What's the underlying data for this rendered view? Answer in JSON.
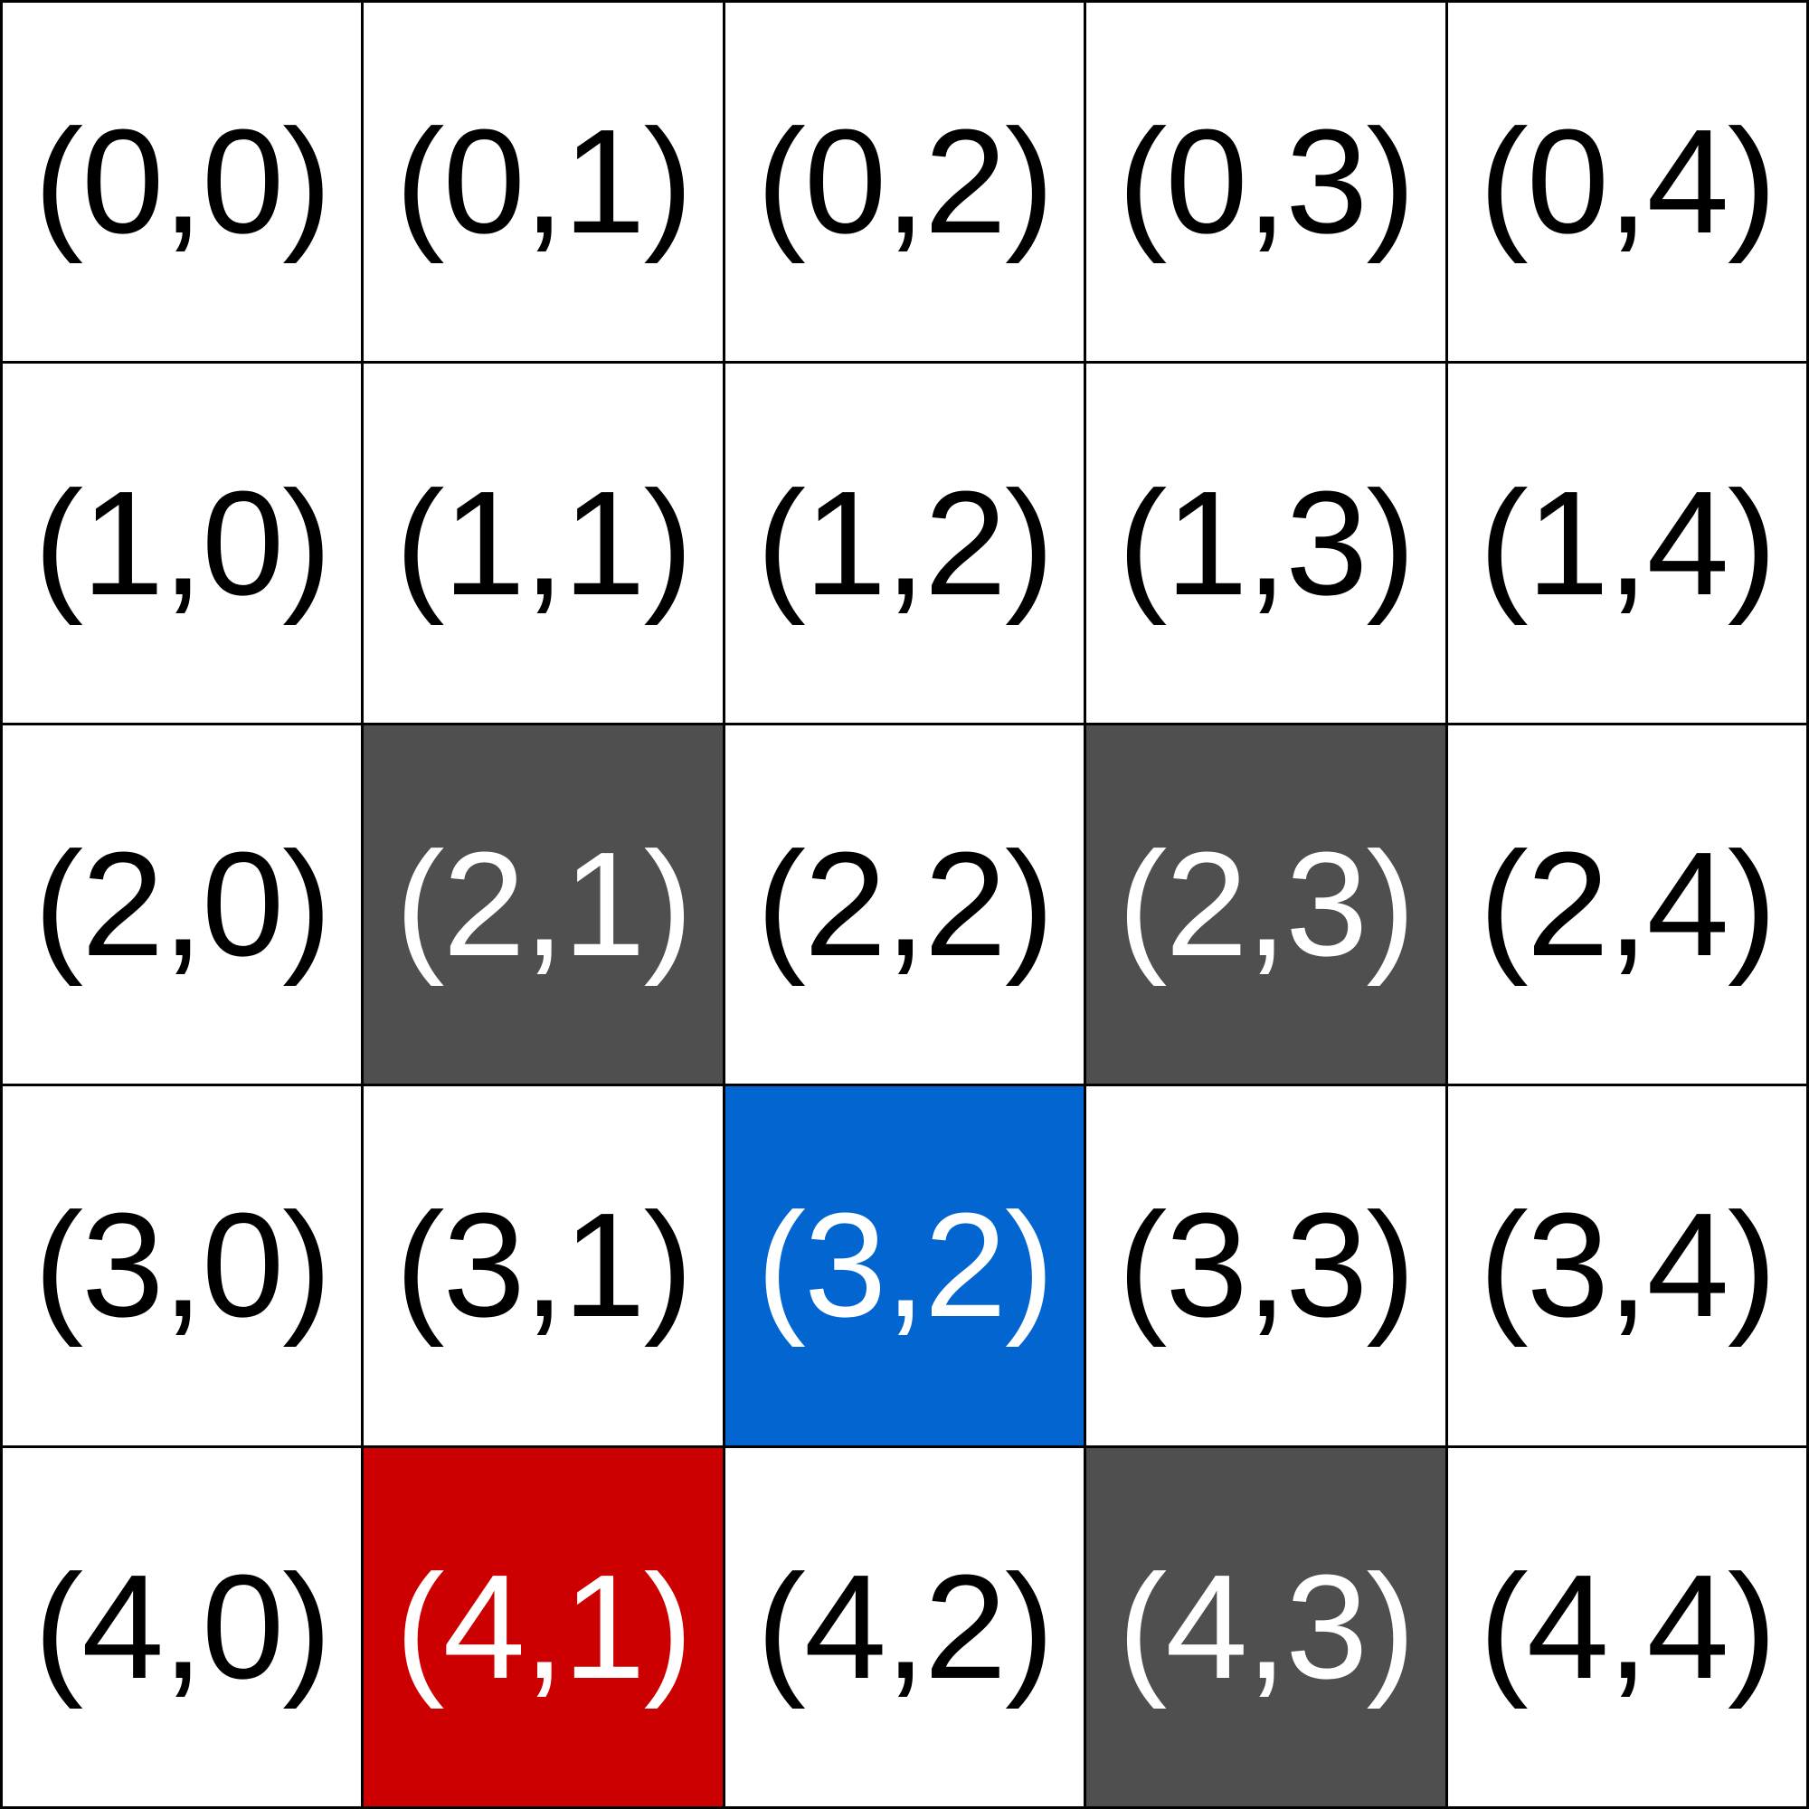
{
  "colors": {
    "empty": "#ffffff",
    "wall": "#4f4f4f",
    "agent": "#0366d0",
    "goal": "#cc0000",
    "dark_text": "#000000",
    "light_text": "#ffffff"
  },
  "grid": {
    "rows": 5,
    "cols": 5,
    "cells": [
      {
        "row": 0,
        "col": 0,
        "label": "(0,0)",
        "type": "empty"
      },
      {
        "row": 0,
        "col": 1,
        "label": "(0,1)",
        "type": "empty"
      },
      {
        "row": 0,
        "col": 2,
        "label": "(0,2)",
        "type": "empty"
      },
      {
        "row": 0,
        "col": 3,
        "label": "(0,3)",
        "type": "empty"
      },
      {
        "row": 0,
        "col": 4,
        "label": "(0,4)",
        "type": "empty"
      },
      {
        "row": 1,
        "col": 0,
        "label": "(1,0)",
        "type": "empty"
      },
      {
        "row": 1,
        "col": 1,
        "label": "(1,1)",
        "type": "empty"
      },
      {
        "row": 1,
        "col": 2,
        "label": "(1,2)",
        "type": "empty"
      },
      {
        "row": 1,
        "col": 3,
        "label": "(1,3)",
        "type": "empty"
      },
      {
        "row": 1,
        "col": 4,
        "label": "(1,4)",
        "type": "empty"
      },
      {
        "row": 2,
        "col": 0,
        "label": "(2,0)",
        "type": "empty"
      },
      {
        "row": 2,
        "col": 1,
        "label": "(2,1)",
        "type": "wall"
      },
      {
        "row": 2,
        "col": 2,
        "label": "(2,2)",
        "type": "empty"
      },
      {
        "row": 2,
        "col": 3,
        "label": "(2,3)",
        "type": "wall"
      },
      {
        "row": 2,
        "col": 4,
        "label": "(2,4)",
        "type": "empty"
      },
      {
        "row": 3,
        "col": 0,
        "label": "(3,0)",
        "type": "empty"
      },
      {
        "row": 3,
        "col": 1,
        "label": "(3,1)",
        "type": "empty"
      },
      {
        "row": 3,
        "col": 2,
        "label": "(3,2)",
        "type": "agent"
      },
      {
        "row": 3,
        "col": 3,
        "label": "(3,3)",
        "type": "empty"
      },
      {
        "row": 3,
        "col": 4,
        "label": "(3,4)",
        "type": "empty"
      },
      {
        "row": 4,
        "col": 0,
        "label": "(4,0)",
        "type": "empty"
      },
      {
        "row": 4,
        "col": 1,
        "label": "(4,1)",
        "type": "goal"
      },
      {
        "row": 4,
        "col": 2,
        "label": "(4,2)",
        "type": "empty"
      },
      {
        "row": 4,
        "col": 3,
        "label": "(4,3)",
        "type": "wall"
      },
      {
        "row": 4,
        "col": 4,
        "label": "(4,4)",
        "type": "empty"
      }
    ]
  }
}
